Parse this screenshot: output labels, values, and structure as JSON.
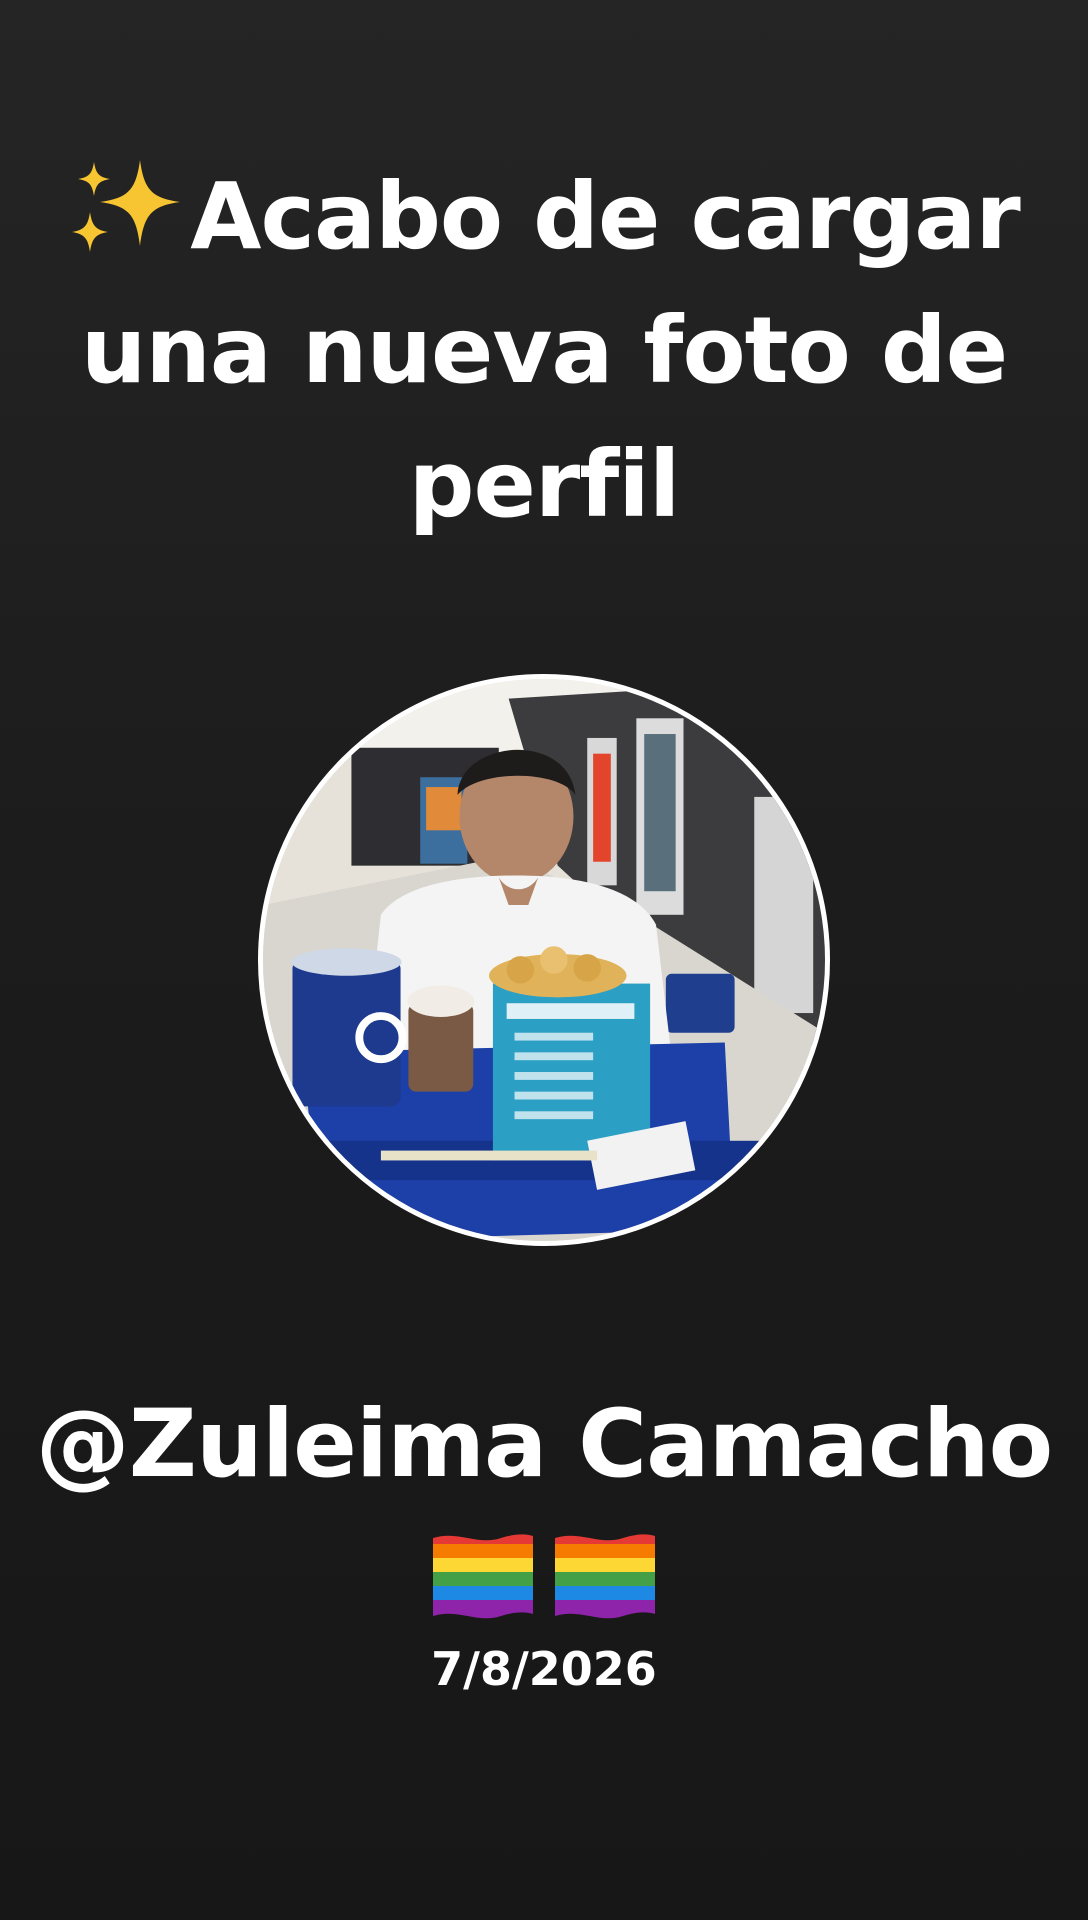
{
  "headline": {
    "icon": "sparkles-icon",
    "text": "Acabo de cargar una nueva foto de perfil"
  },
  "profile_photo": {
    "icon": "profile-photo",
    "ring_color": "#ffffff"
  },
  "username": "@Zuleima Camacho",
  "flags": [
    {
      "icon": "rainbow-flag-icon"
    },
    {
      "icon": "rainbow-flag-icon"
    }
  ],
  "date": "7/8/2026",
  "colors": {
    "background_top": "#252525",
    "background_bottom": "#171717",
    "text": "#ffffff",
    "sparkle": "#f7c531"
  }
}
